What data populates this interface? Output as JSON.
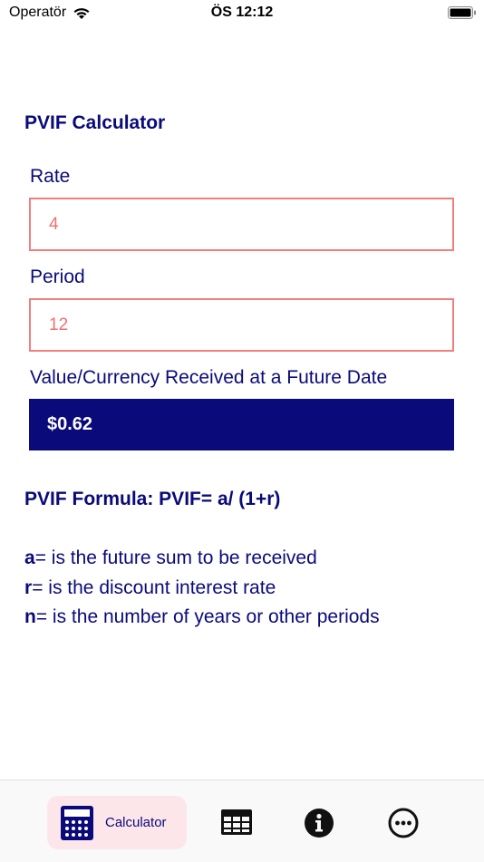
{
  "status": {
    "carrier": "Operatör",
    "time": "ÖS 12:12"
  },
  "page": {
    "title": "PVIF Calculator"
  },
  "form": {
    "rate_label": "Rate",
    "rate_value": "4",
    "period_label": "Period",
    "period_value": "12",
    "result_label": "Value/Currency Received at a Future Date",
    "result_value": "$0.62"
  },
  "formula": {
    "title": "PVIF Formula: PVIF= a/ (1+r)",
    "definitions": [
      {
        "var": "a",
        "text": "= is the future sum to be received"
      },
      {
        "var": "r",
        "text": "= is the discount interest rate"
      },
      {
        "var": "n",
        "text": "= is the number of years or other periods"
      }
    ]
  },
  "tabs": [
    {
      "label": "Calculator",
      "icon": "calculator-icon",
      "active": true
    },
    {
      "label": "",
      "icon": "table-icon",
      "active": false
    },
    {
      "label": "",
      "icon": "info-icon",
      "active": false
    },
    {
      "label": "",
      "icon": "more-icon",
      "active": false
    }
  ],
  "colors": {
    "primary": "#0a0a7a",
    "input_border": "#f08080",
    "input_text": "#f07070",
    "tab_active_bg": "#fde6ea"
  }
}
